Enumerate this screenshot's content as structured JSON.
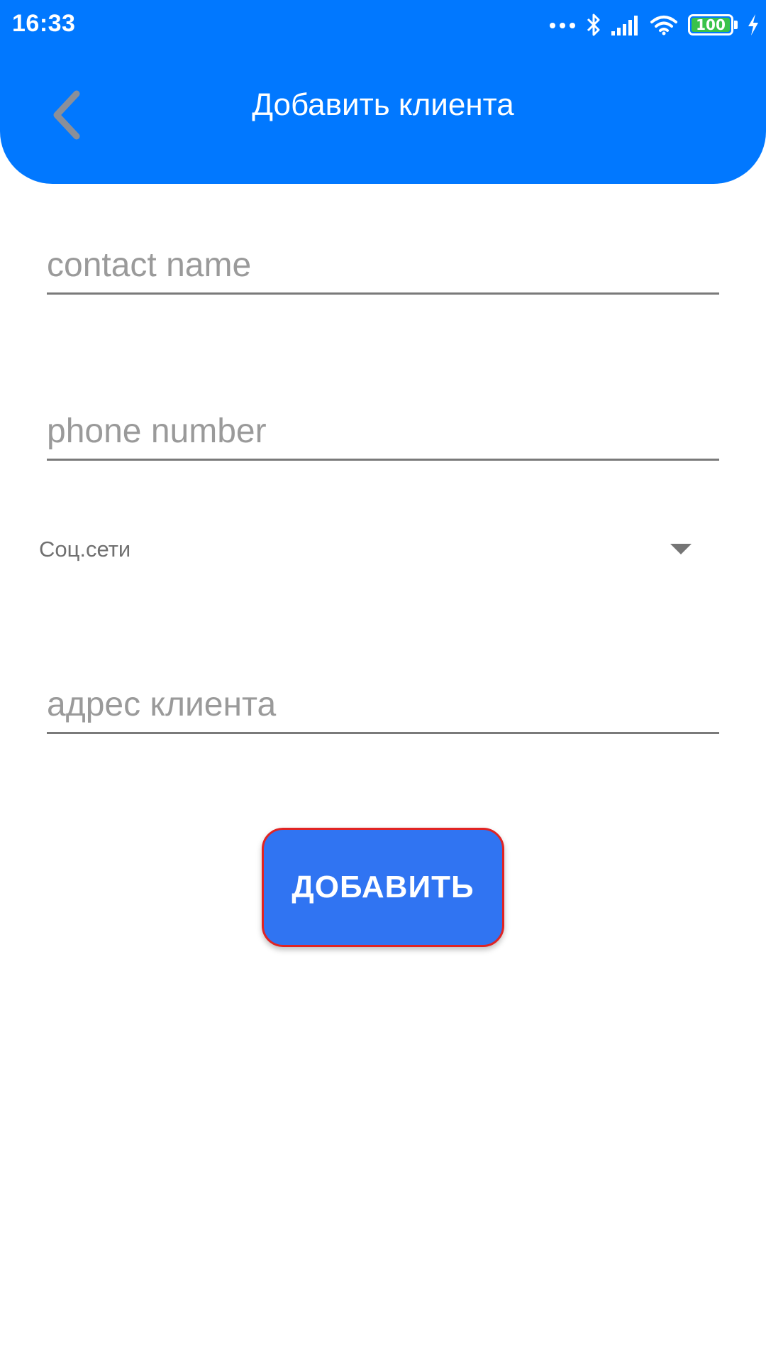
{
  "status_bar": {
    "time": "16:33",
    "battery_level": "100",
    "icons": [
      "more-dots-icon",
      "bluetooth-icon",
      "signal-icon",
      "wifi-icon",
      "battery-icon",
      "charging-icon"
    ]
  },
  "toolbar": {
    "back_icon": "chevron-left-icon",
    "title": "Добавить клиента"
  },
  "form": {
    "contact_name_placeholder": "contact name",
    "phone_placeholder": "phone number",
    "social_spinner_value": "Соц.сети",
    "address_placeholder": "адрес клиента",
    "submit_label": "ДОБАВИТЬ"
  },
  "colors": {
    "header": "#0178FF",
    "button": "#3074F2",
    "button_border": "#E02424",
    "battery_fill": "#39C24A"
  }
}
